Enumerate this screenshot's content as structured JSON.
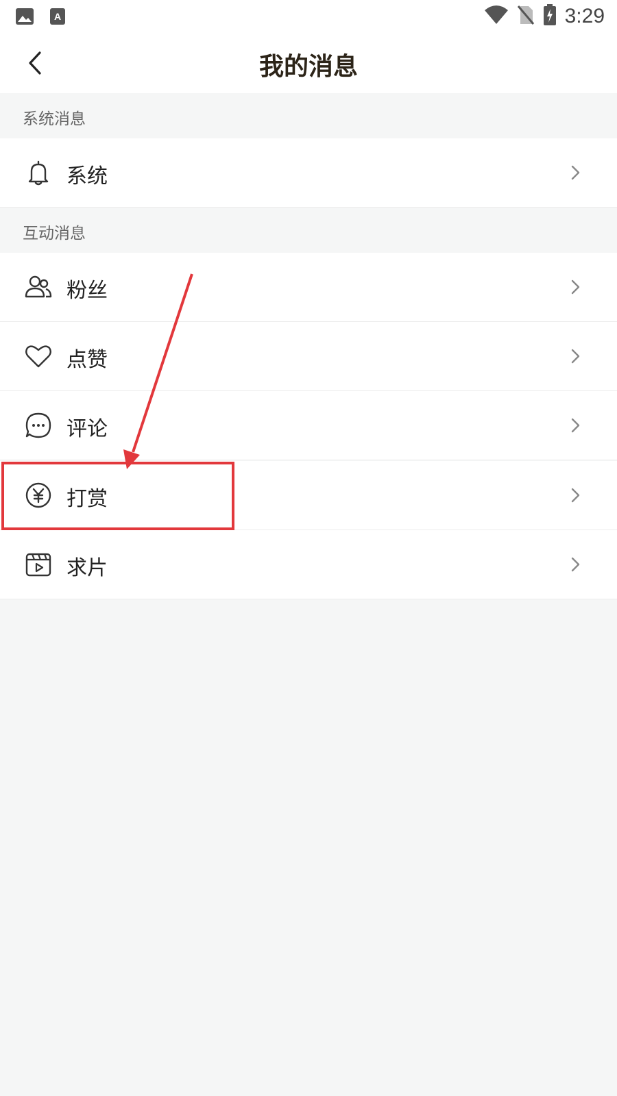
{
  "status_bar": {
    "time": "3:29",
    "left_icons": [
      "gallery-icon",
      "font-app-icon"
    ],
    "right_icons": [
      "wifi-icon",
      "no-sim-icon",
      "battery-charging-icon"
    ]
  },
  "header": {
    "title": "我的消息",
    "back_icon": "back-arrow-icon"
  },
  "sections": [
    {
      "title": "系统消息",
      "items": [
        {
          "label": "系统",
          "icon": "bell-icon"
        }
      ]
    },
    {
      "title": "互动消息",
      "items": [
        {
          "label": "粉丝",
          "icon": "users-icon"
        },
        {
          "label": "点赞",
          "icon": "heart-icon"
        },
        {
          "label": "评论",
          "icon": "comment-icon"
        },
        {
          "label": "打赏",
          "icon": "yen-coin-icon"
        },
        {
          "label": "求片",
          "icon": "video-request-icon"
        }
      ]
    }
  ],
  "colors": {
    "annotation": "#e2383c",
    "background": "#f5f6f6",
    "title": "#2c2418"
  }
}
